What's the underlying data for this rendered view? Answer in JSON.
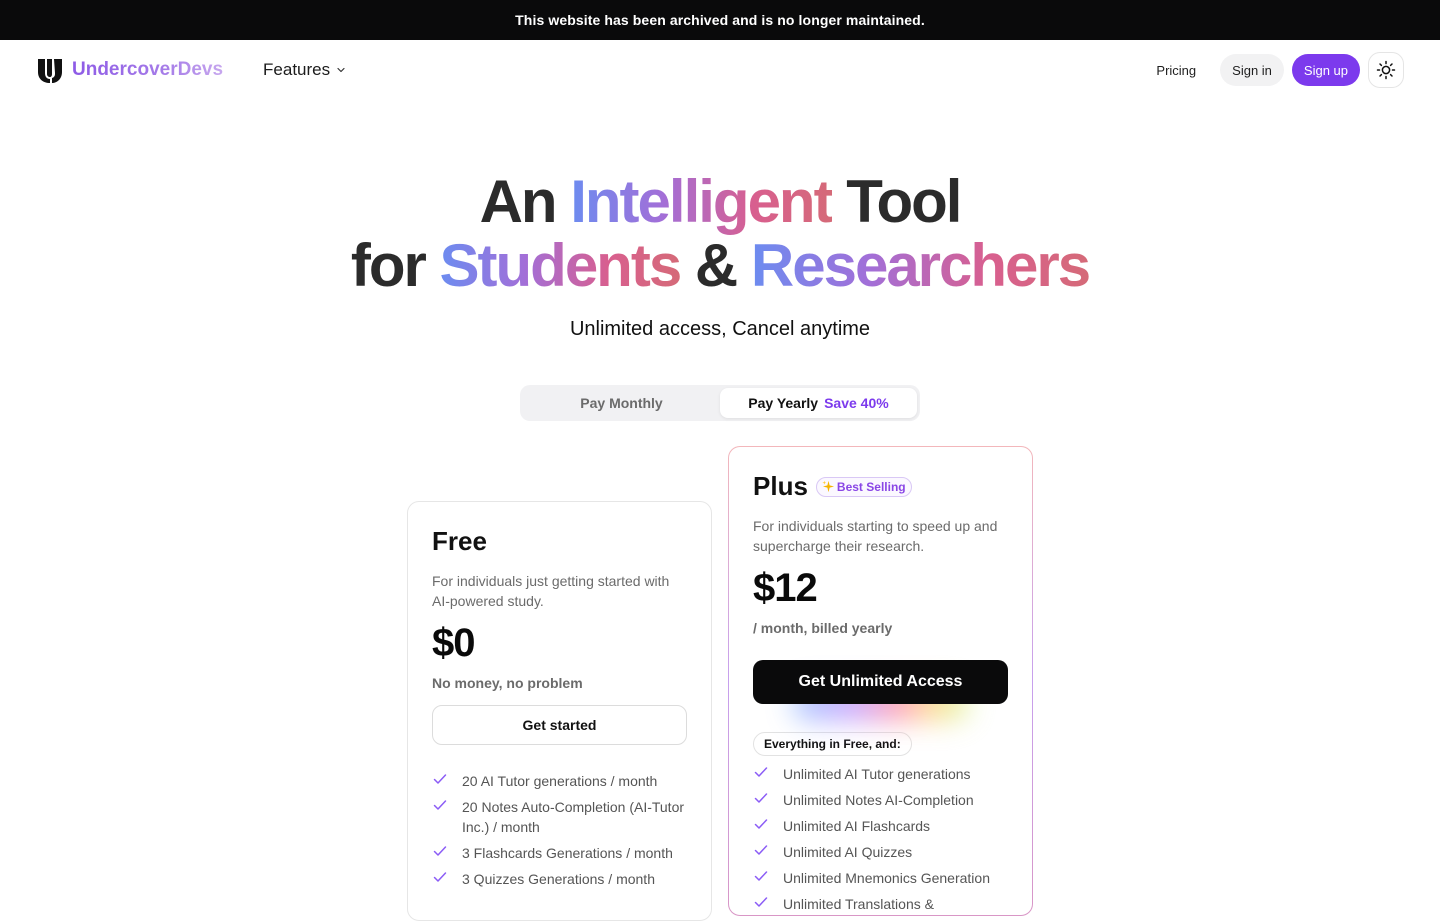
{
  "banner": {
    "text": "This website has been archived and is no longer maintained."
  },
  "nav": {
    "logo_text": "UndercoverDevs",
    "features_label": "Features",
    "pricing_label": "Pricing",
    "signin_label": "Sign in",
    "signup_label": "Sign up"
  },
  "hero": {
    "line1_a": "An",
    "line1_b": "Intelligent",
    "line1_c": "Tool",
    "line2_a": "for",
    "line2_b": "Students",
    "line2_c": "&",
    "line2_d": "Researchers",
    "subtitle": "Unlimited access, Cancel anytime"
  },
  "billing": {
    "monthly_label": "Pay Monthly",
    "yearly_label": "Pay Yearly",
    "save_label": "Save 40%",
    "selected": "yearly"
  },
  "plans": {
    "free": {
      "name": "Free",
      "description": "For individuals just getting started with AI-powered study.",
      "price": "$0",
      "price_note": "No money, no problem",
      "cta": "Get started",
      "features": [
        "20 AI Tutor generations / month",
        "20 Notes Auto-Completion (AI-Tutor Inc.) / month",
        "3 Flashcards Generations / month",
        "3 Quizzes Generations / month"
      ]
    },
    "plus": {
      "name": "Plus",
      "badge": "Best Selling",
      "description": "For individuals starting to speed up and supercharge their research.",
      "price": "$12",
      "price_note": "/ month, billed yearly",
      "cta": "Get Unlimited Access",
      "everything_label": "Everything in Free, and:",
      "features": [
        "Unlimited AI Tutor generations",
        "Unlimited Notes AI-Completion",
        "Unlimited AI Flashcards",
        "Unlimited AI Quizzes",
        "Unlimited Mnemonics Generation",
        "Unlimited Translations &"
      ]
    }
  },
  "colors": {
    "accent": "#7c3aed",
    "banner_bg": "#0a0a0b",
    "check": "#8b5cf6"
  },
  "icons": {
    "logo": "undercover-logo-icon",
    "features_chevron": "chevron-down-icon",
    "theme": "sun-icon",
    "badge": "sparkles-icon",
    "feature_item": "check-icon"
  }
}
